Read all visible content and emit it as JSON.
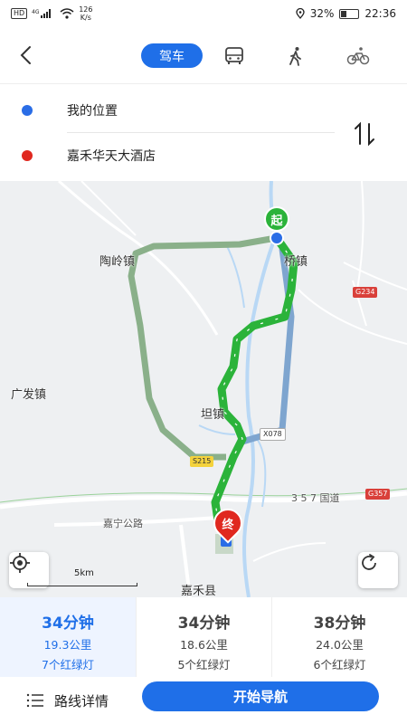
{
  "status_bar": {
    "network_badge": "HD",
    "signal_type": "4G",
    "speed_value": "126",
    "speed_unit": "K/s",
    "battery": "32%",
    "time": "22:36"
  },
  "header": {
    "modes": [
      {
        "label": "驾车",
        "active": true,
        "icon": "car"
      },
      {
        "label": "",
        "active": false,
        "icon": "bus-icon"
      },
      {
        "label": "",
        "active": false,
        "icon": "walk-icon"
      },
      {
        "label": "",
        "active": false,
        "icon": "bike-icon"
      }
    ]
  },
  "route": {
    "start": "我的位置",
    "end": "嘉禾华天大酒店",
    "start_color": "#2a6de6",
    "end_color": "#e0281f"
  },
  "map": {
    "labels": {
      "taoling": "陶岭镇",
      "qiaozhen": "桥镇",
      "guangfa": "广发镇",
      "tanzhen": "坦镇",
      "jiahe_county": "嘉禾县",
      "jianing_road": "嘉宁公路",
      "guodao": "3 5 7 国道"
    },
    "road_tags": {
      "g234": "G234",
      "s215": "S215",
      "x078": "X078",
      "g357": "G357"
    },
    "start_marker": "起",
    "end_marker": "终",
    "scale_label": "5km",
    "route_color": "#2bb33a",
    "alt_route_color_1": "#8ab08a",
    "alt_route_color_2": "#7ea5cf"
  },
  "options": [
    {
      "time": "34分钟",
      "distance": "19.3公里",
      "lights": "7个红绿灯",
      "active": true
    },
    {
      "time": "34分钟",
      "distance": "18.6公里",
      "lights": "5个红绿灯",
      "active": false
    },
    {
      "time": "38分钟",
      "distance": "24.0公里",
      "lights": "6个红绿灯",
      "active": false
    }
  ],
  "bottom": {
    "details_label": "路线详情",
    "navigate_label": "开始导航"
  },
  "colors": {
    "accent": "#1f6fe8"
  }
}
